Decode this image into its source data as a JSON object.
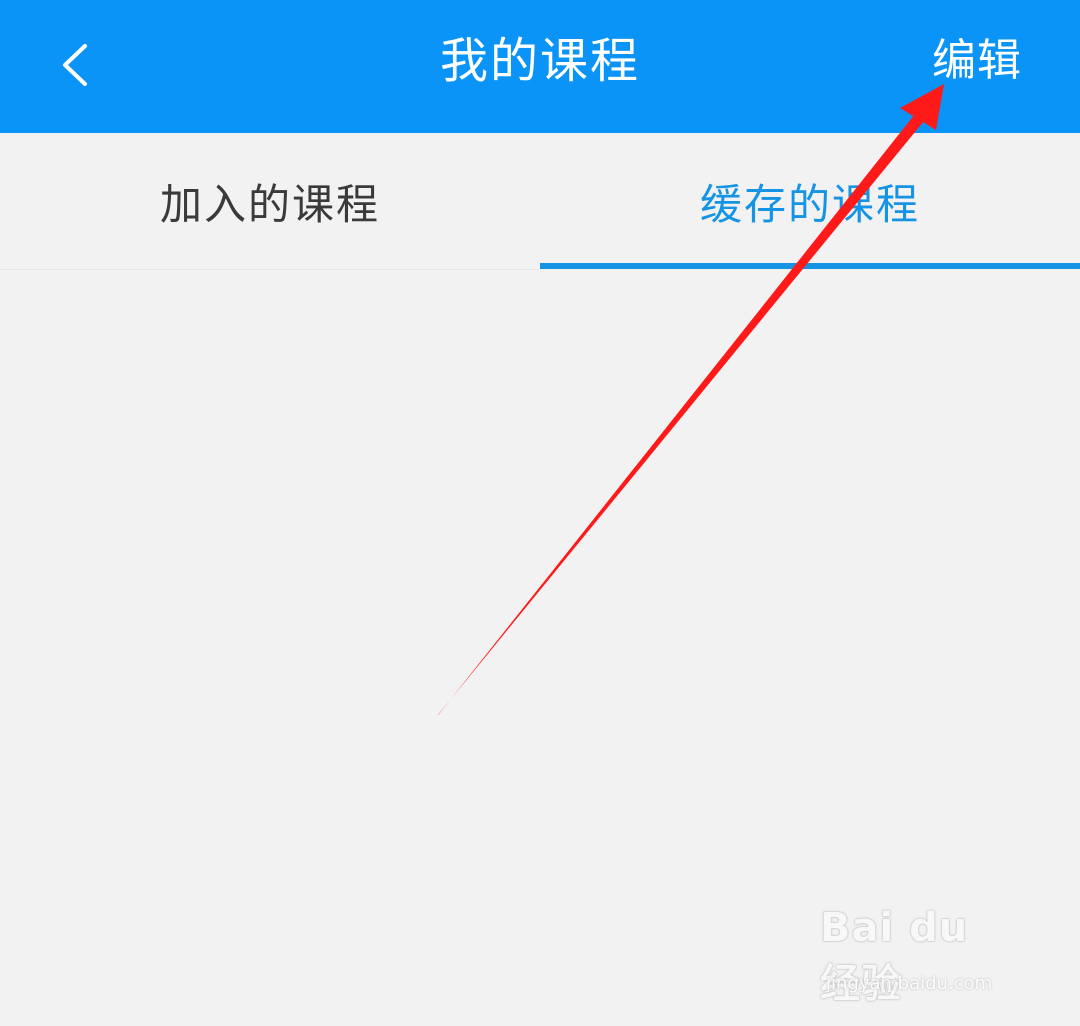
{
  "header": {
    "title": "我的课程",
    "back_icon": "chevron-left-icon",
    "edit_label": "编辑",
    "background_color": "#0a94f7"
  },
  "tabs": [
    {
      "label": "加入的课程",
      "active": false
    },
    {
      "label": "缓存的课程",
      "active": true
    }
  ],
  "colors": {
    "active_tab": "#1593e4",
    "inactive_tab": "#3a3a3a",
    "page_background": "#f2f2f2",
    "annotation_arrow": "#ff1a1a"
  },
  "watermark": {
    "brand": "Bai du 经验",
    "domain": "jingyan.baidu.com"
  }
}
